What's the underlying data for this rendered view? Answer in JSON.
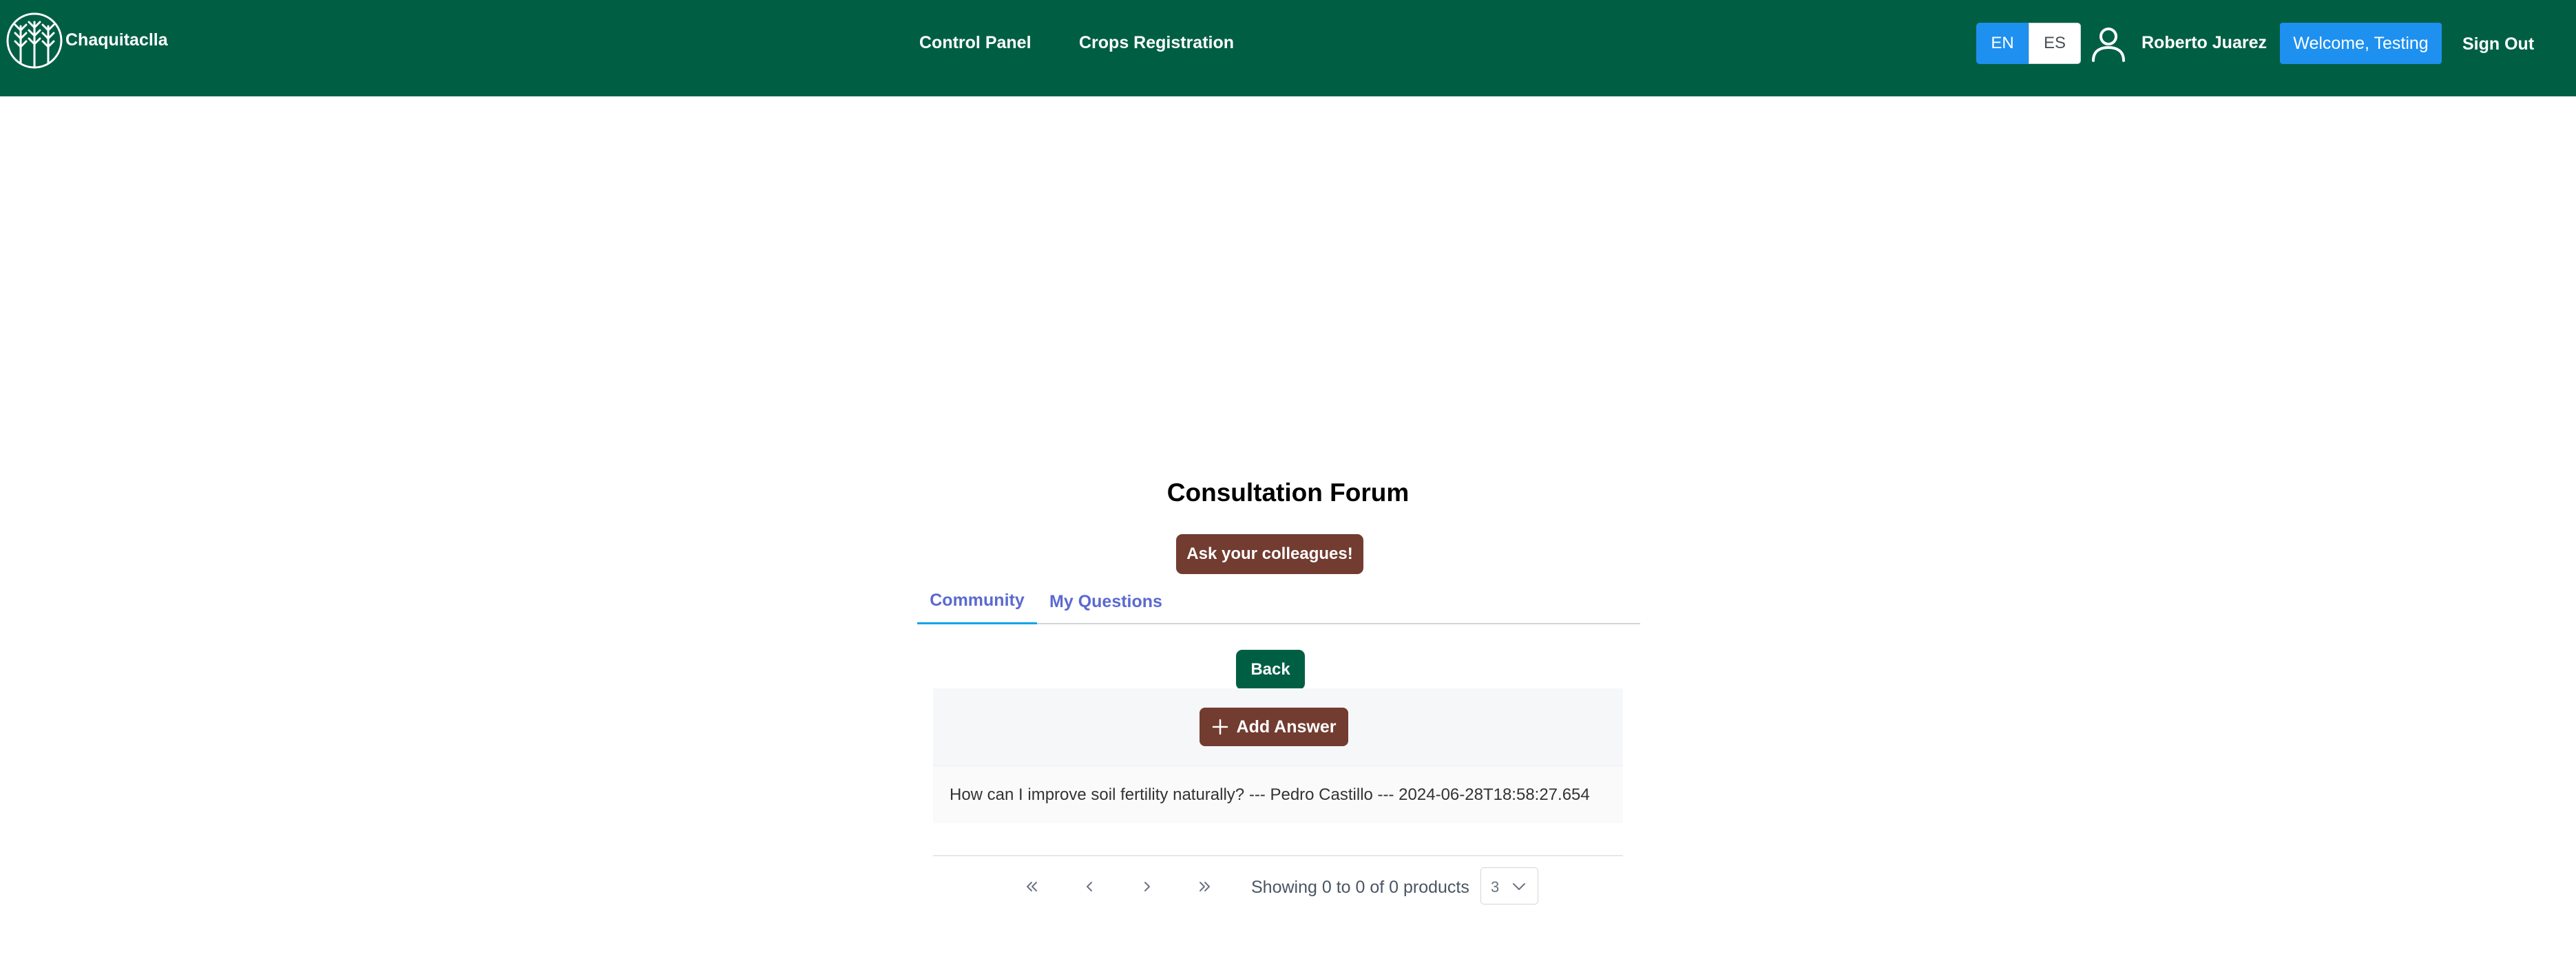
{
  "header": {
    "brand": "Chaquitaclla",
    "nav": [
      {
        "label": "Control Panel"
      },
      {
        "label": "Crops Registration"
      }
    ],
    "languages": [
      {
        "label": "EN",
        "active": true
      },
      {
        "label": "ES",
        "active": false
      }
    ],
    "user_name": "Roberto Juarez",
    "welcome_label": "Welcome, Testing",
    "sign_out_label": "Sign Out",
    "icons": {
      "logo": "wheat-logo-icon",
      "user": "user-icon"
    }
  },
  "forum": {
    "title": "Consultation Forum",
    "ask_button": "Ask your colleagues!",
    "tabs": [
      {
        "label": "Community",
        "active": true
      },
      {
        "label": "My Questions",
        "active": false
      }
    ],
    "back_button": "Back",
    "add_answer_button": "Add Answer",
    "question_row": "How can I improve soil fertility naturally? --- Pedro Castillo --- 2024-06-28T18:58:27.654"
  },
  "pagination": {
    "info": "Showing 0 to 0 of 0 products",
    "rows_per_page": "3",
    "icons": [
      "first-page-icon",
      "prev-page-icon",
      "next-page-icon",
      "last-page-icon",
      "chevron-down-icon"
    ]
  },
  "colors": {
    "header_bg": "#005f43",
    "primary_blue": "#1e90ef",
    "brown_button": "#723c30",
    "green_button": "#005f43",
    "tab_text": "#5b6ad0",
    "tab_active_underline": "#0ea5e9"
  }
}
